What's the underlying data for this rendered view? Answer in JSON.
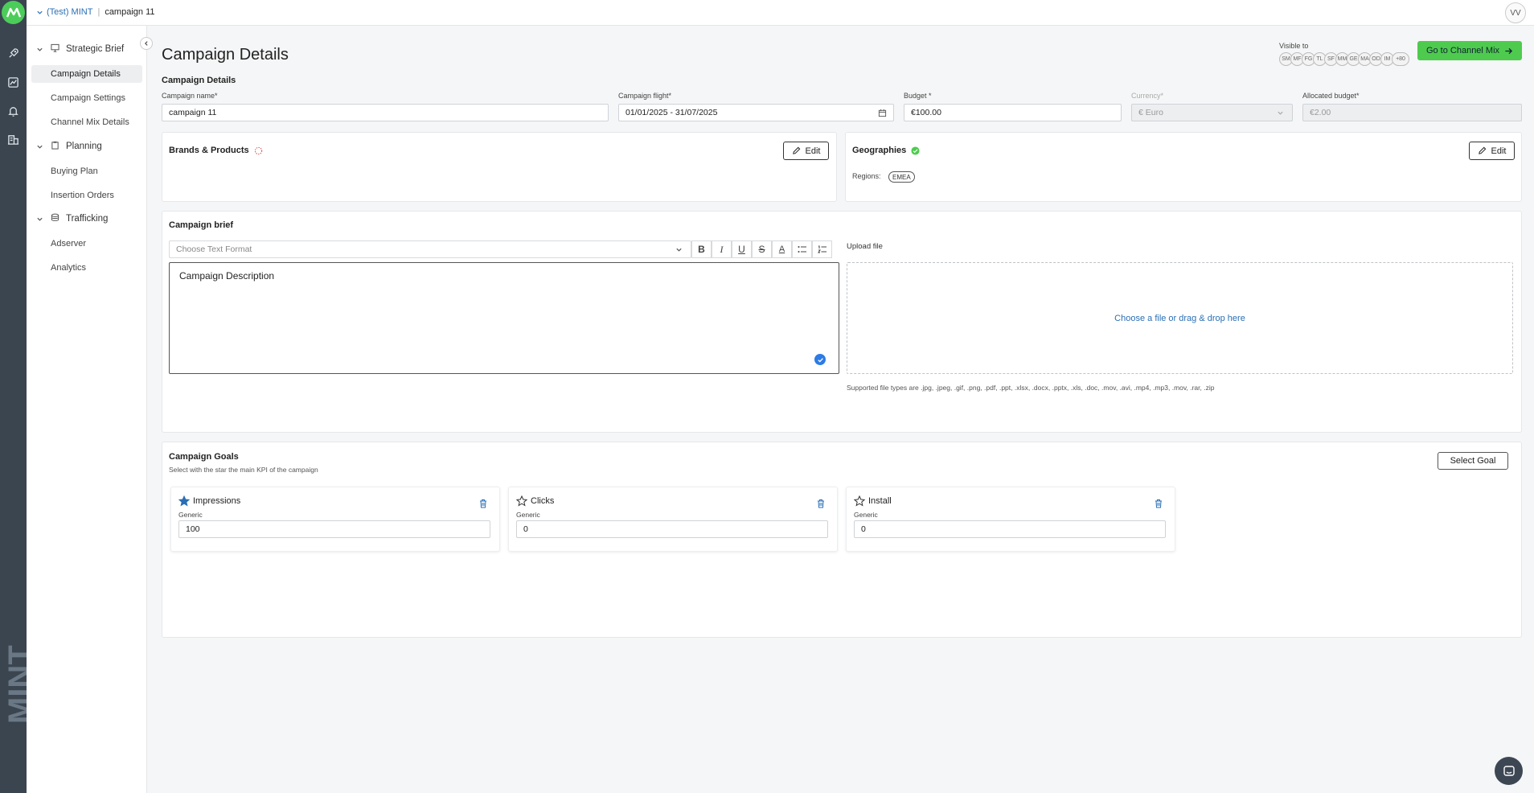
{
  "app": {
    "brand_text": "MINT",
    "colors": {
      "accent_green": "#4ecb4e",
      "link_blue": "#2a6fb5",
      "rail": "#3a4550"
    }
  },
  "topbar": {
    "org": "(Test) MINT",
    "separator": "|",
    "campaign": "campaign 11",
    "avatar_initials": "VV"
  },
  "sidebar": {
    "sections": [
      {
        "label": "Strategic Brief",
        "icon": "presentation-icon",
        "items": [
          "Campaign Details",
          "Campaign Settings",
          "Channel Mix Details"
        ]
      },
      {
        "label": "Planning",
        "icon": "clipboard-icon",
        "items": [
          "Buying Plan",
          "Insertion Orders"
        ]
      },
      {
        "label": "Trafficking",
        "icon": "database-icon",
        "items": [
          "Adserver",
          "Analytics"
        ]
      }
    ],
    "active_item": "Campaign Details"
  },
  "header": {
    "title": "Campaign Details",
    "visible_to_label": "Visible to",
    "visible_to_chips": [
      "SM",
      "MF",
      "FG",
      "TL",
      "SF",
      "MM",
      "GE",
      "MA",
      "OD",
      "IM",
      "+80"
    ],
    "go_button": "Go to Channel Mix"
  },
  "details": {
    "section_label": "Campaign Details",
    "campaign_name_label": "Campaign name*",
    "campaign_name_value": "campaign 11",
    "flight_label": "Campaign flight*",
    "flight_value": "01/01/2025 - 31/07/2025",
    "budget_label": "Budget *",
    "budget_value": "€100.00",
    "currency_label": "Currency*",
    "currency_value": "€ Euro",
    "allocated_label": "Allocated budget*",
    "allocated_value": "€2.00"
  },
  "brands": {
    "title": "Brands & Products",
    "edit_label": "Edit"
  },
  "geographies": {
    "title": "Geographies",
    "edit_label": "Edit",
    "regions_label": "Regions:",
    "regions": [
      "EMEA"
    ]
  },
  "brief": {
    "title": "Campaign brief",
    "format_placeholder": "Choose Text Format",
    "toolbar_buttons": [
      "B",
      "I",
      "U",
      "S",
      "A",
      "bullet-list",
      "numbered-list"
    ],
    "description": "Campaign Description",
    "upload_label": "Upload file",
    "dropzone_text": "Choose a file or drag & drop here",
    "supported_text": "Supported file types are .jpg, .jpeg, .gif, .png, .pdf, .ppt, .xlsx, .docx, .pptx, .xls, .doc, .mov, .avi, .mp4, .mp3, .mov, .rar, .zip"
  },
  "goals": {
    "title": "Campaign Goals",
    "subtitle": "Select with the star the main KPI of the campaign",
    "select_button": "Select Goal",
    "items": [
      {
        "name": "Impressions",
        "type": "Generic",
        "value": "100",
        "starred": true
      },
      {
        "name": "Clicks",
        "type": "Generic",
        "value": "0",
        "starred": false
      },
      {
        "name": "Install",
        "type": "Generic",
        "value": "0",
        "starred": false
      }
    ]
  }
}
